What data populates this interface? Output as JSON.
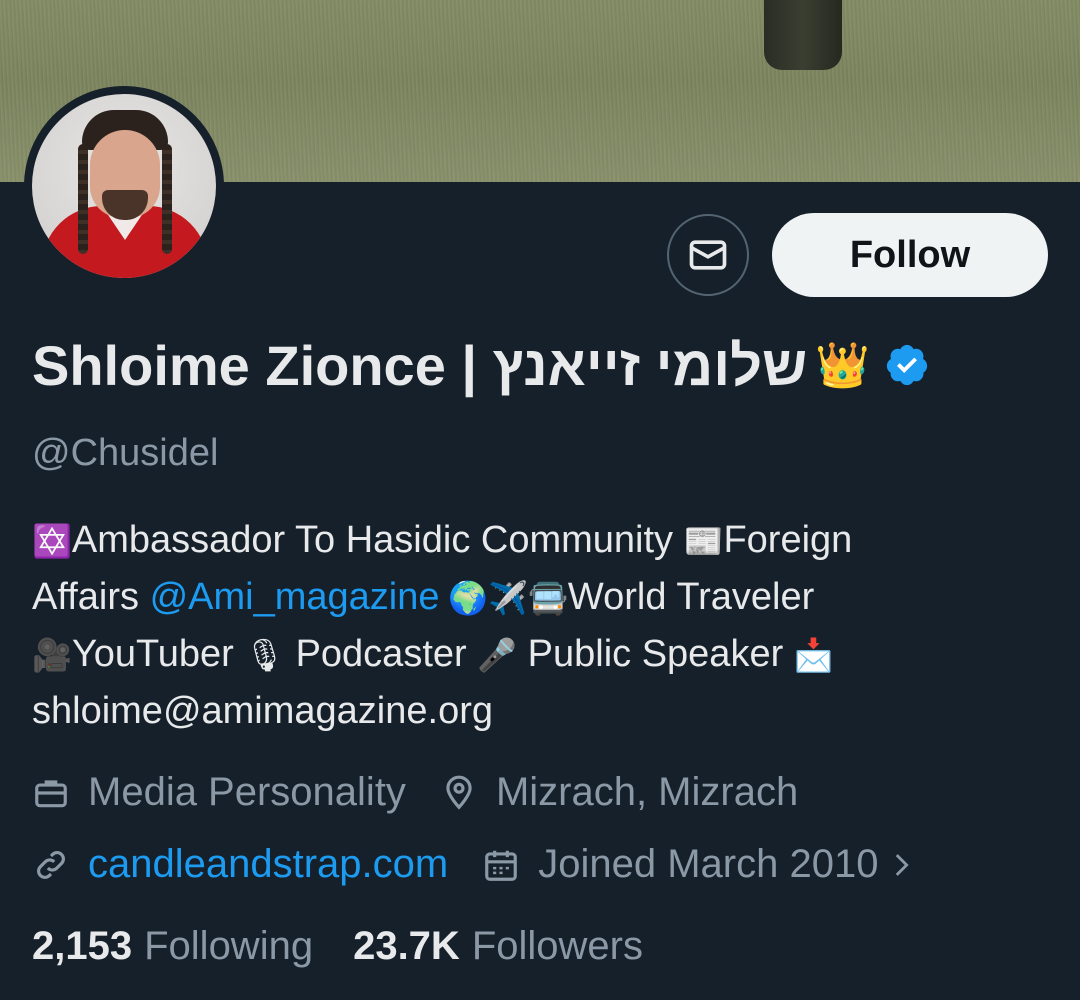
{
  "profile": {
    "name": "Shloime Zionce | שלומי זייאנץ",
    "name_emoji": "👑",
    "handle": "@Chusidel",
    "follow_label": "Follow",
    "bio": {
      "line1_a": "✡️",
      "line1_b": "Ambassador To Hasidic Community ",
      "line1_c": "📰",
      "line1_d": "Foreign",
      "line2_a": "Affairs ",
      "line2_link": "@Ami_magazine",
      "line2_b": " 🌍✈️🚍",
      "line2_c": "World Traveler",
      "line3_a": "🎥",
      "line3_b": "YouTuber ",
      "line3_c": "🎙",
      "line3_d": " Podcaster ",
      "line3_e": "🎤",
      "line3_f": " Public Speaker ",
      "line3_g": "📩",
      "line4": "shloime@amimagazine.org"
    },
    "category": "Media Personality",
    "location": "Mizrach, Mizrach",
    "website": "candleandstrap.com",
    "joined": "Joined March 2010",
    "following_count": "2,153",
    "following_label": "Following",
    "followers_count": "23.7K",
    "followers_label": "Followers"
  },
  "colors": {
    "background": "#15202b",
    "accent": "#1d9bf0",
    "muted": "#8b98a5"
  }
}
